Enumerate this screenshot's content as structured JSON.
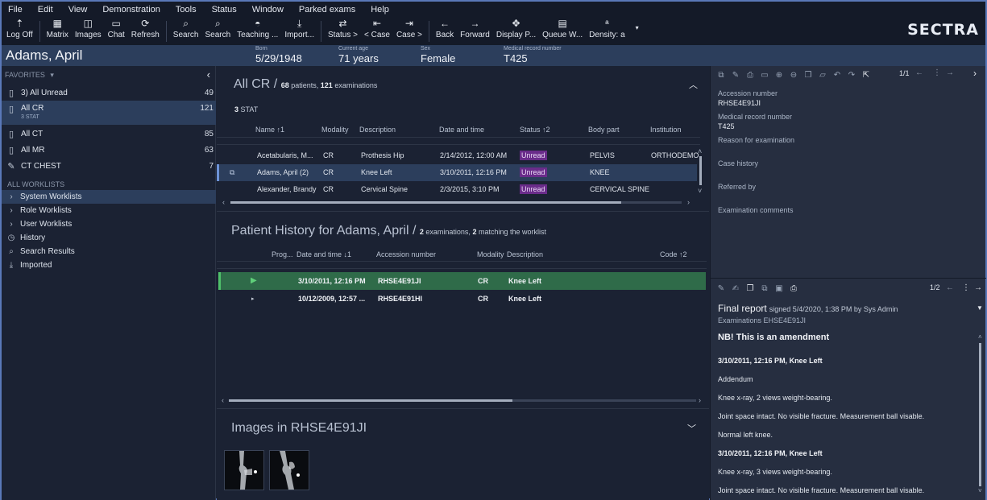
{
  "menu": [
    "File",
    "Edit",
    "View",
    "Demonstration",
    "Tools",
    "Status",
    "Window",
    "Parked exams",
    "Help"
  ],
  "toolbar": [
    {
      "label": "Log Off",
      "icon": "logoff-icon"
    },
    {
      "label": "Matrix",
      "icon": "matrix-icon"
    },
    {
      "label": "Images",
      "icon": "images-icon"
    },
    {
      "label": "Chat",
      "icon": "chat-icon"
    },
    {
      "label": "Refresh",
      "icon": "refresh-icon"
    },
    {
      "label": "Search",
      "icon": "search-icon"
    },
    {
      "label": "Search",
      "icon": "search-advanced-icon"
    },
    {
      "label": "Teaching ...",
      "icon": "teaching-icon"
    },
    {
      "label": "Import...",
      "icon": "import-icon"
    },
    {
      "label": "Status >",
      "icon": "status-icon"
    },
    {
      "label": "< Case",
      "icon": "prev-case-icon"
    },
    {
      "label": "Case >",
      "icon": "next-case-icon"
    },
    {
      "label": "Back",
      "icon": "back-arrow-icon"
    },
    {
      "label": "Forward",
      "icon": "forward-arrow-icon"
    },
    {
      "label": "Display P...",
      "icon": "display-protocol-icon"
    },
    {
      "label": "Queue W...",
      "icon": "queue-icon"
    },
    {
      "label": "Density: a",
      "icon": "density-icon"
    }
  ],
  "brand": "SECTRA",
  "patient": {
    "name": "Adams, April",
    "born_label": "Born",
    "born": "5/29/1948",
    "age_label": "Current age",
    "age": "71 years",
    "sex_label": "Sex",
    "sex": "Female",
    "mrn_label": "Medical record number",
    "mrn": "T425"
  },
  "left": {
    "favorites_label": "FAVORITES",
    "favorites": [
      {
        "label": "3) All Unread",
        "count": "49"
      },
      {
        "label": "All CR",
        "count": "121",
        "sub": "3 STAT"
      },
      {
        "label": "All CT",
        "count": "85"
      },
      {
        "label": "All MR",
        "count": "63"
      },
      {
        "label": "CT CHEST",
        "count": "7"
      }
    ],
    "worklists_label": "ALL WORKLISTS",
    "worklists": [
      "System Worklists",
      "Role Worklists",
      "User Worklists",
      "History",
      "Search Results",
      "Imported"
    ]
  },
  "worklist": {
    "title": "All CR /",
    "patients_count": "68",
    "patients_word": "patients,",
    "exams_count": "121",
    "exams_word": "examinations",
    "stat_count": "3",
    "stat_word": "STAT",
    "columns": [
      "Name ↑1",
      "Modality",
      "Description",
      "Date and time",
      "Status ↑2",
      "Body part",
      "Institution"
    ],
    "rows": [
      {
        "name": "Acetabularis, M...",
        "modality": "CR",
        "description": "Prothesis Hip",
        "datetime": "2/14/2012, 12:00 AM",
        "status": "Unread",
        "body": "PELVIS",
        "institution": "ORTHODEMO"
      },
      {
        "name": "Adams, April (2)",
        "modality": "CR",
        "description": "Knee Left",
        "datetime": "3/10/2011, 12:16 PM",
        "status": "Unread",
        "body": "KNEE",
        "institution": ""
      },
      {
        "name": "Alexander, Brandy",
        "modality": "CR",
        "description": "Cervical Spine",
        "datetime": "2/3/2015, 3:10 PM",
        "status": "Unread",
        "body": "CERVICAL SPINE",
        "institution": ""
      }
    ]
  },
  "history": {
    "title": "Patient History for Adams, April /",
    "exams_count": "2",
    "exams_word": "examinations,",
    "match_count": "2",
    "match_word": "matching the worklist",
    "columns": [
      "Prog...",
      "Date and time ↓1",
      "Accession number",
      "Modality",
      "Description",
      "Code ↑2"
    ],
    "rows": [
      {
        "datetime": "3/10/2011, 12:16 PM",
        "accession": "RHSE4E91JI",
        "modality": "CR",
        "description": "Knee Left"
      },
      {
        "datetime": "10/12/2009, 12:57 ...",
        "accession": "RHSE4E91HI",
        "modality": "CR",
        "description": "Knee Left"
      }
    ]
  },
  "images": {
    "title": "Images in RHSE4E91JI"
  },
  "details": {
    "pager": "1/1",
    "fields": [
      {
        "label": "Accession number",
        "value": "RHSE4E91JI"
      },
      {
        "label": "Medical record number",
        "value": "T425"
      },
      {
        "label": "Reason for examination",
        "value": ""
      },
      {
        "label": "Case history",
        "value": ""
      },
      {
        "label": "Referred by",
        "value": ""
      },
      {
        "label": "Examination comments",
        "value": ""
      }
    ]
  },
  "report": {
    "pager": "1/2",
    "title": "Final report",
    "signed": "signed 5/4/2020, 1:38 PM by Sys Admin",
    "examinations": "Examinations EHSE4E91JI",
    "lines": [
      {
        "text": "NB! This is an amendment",
        "bold": true
      },
      {
        "text": "3/10/2011, 12:16 PM, Knee Left",
        "bold": true
      },
      {
        "text": "Addendum",
        "bold": false
      },
      {
        "text": "Knee x-ray, 2 views weight-bearing.",
        "bold": false
      },
      {
        "text": "Joint space intact. No visible fracture. Measurement ball visable.",
        "bold": false
      },
      {
        "text": "Normal left knee.",
        "bold": false
      },
      {
        "text": "3/10/2011, 12:16 PM, Knee Left",
        "bold": true
      },
      {
        "text": "Knee x-ray, 3 views weight-bearing.",
        "bold": false
      },
      {
        "text": "Joint space intact. No visible fracture. Measurement ball visable.",
        "bold": false
      }
    ]
  }
}
